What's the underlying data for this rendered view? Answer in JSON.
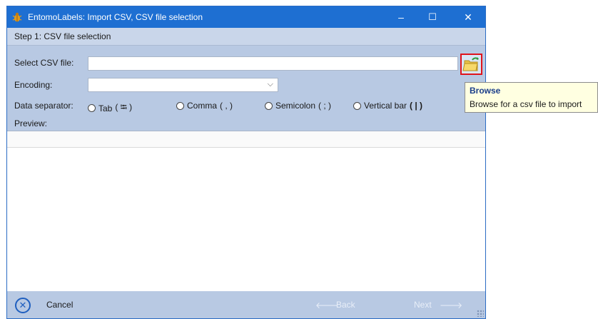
{
  "window": {
    "title": "EntomoLabels: Import CSV, CSV file selection",
    "app_icon": "bug-icon",
    "controls": {
      "minimize": "–",
      "maximize": "☐",
      "close": "✕"
    }
  },
  "step": {
    "label": "Step 1: CSV file selection"
  },
  "form": {
    "csv_file_label": "Select CSV file:",
    "csv_file_value": "",
    "browse_icon": "folder-open-icon",
    "encoding_label": "Encoding:",
    "encoding_value": "",
    "separator_label": "Data separator:",
    "separators": [
      {
        "label": "Tab",
        "symbol": "( ⭾ )"
      },
      {
        "label": "Comma",
        "symbol": "( , )"
      },
      {
        "label": "Semicolon",
        "symbol": "( ; )"
      },
      {
        "label": "Vertical bar",
        "symbol": "( | )"
      }
    ],
    "preview_label": "Preview:"
  },
  "footer": {
    "cancel_label": "Cancel",
    "back_label": "Back",
    "next_label": "Next"
  },
  "tooltip": {
    "title": "Browse",
    "body": "Browse for a csv file to import"
  },
  "colors": {
    "titlebar": "#1e6fd2",
    "window_bg": "#b8c9e3",
    "highlight_border": "#e0141c",
    "tooltip_bg": "#ffffe1"
  }
}
